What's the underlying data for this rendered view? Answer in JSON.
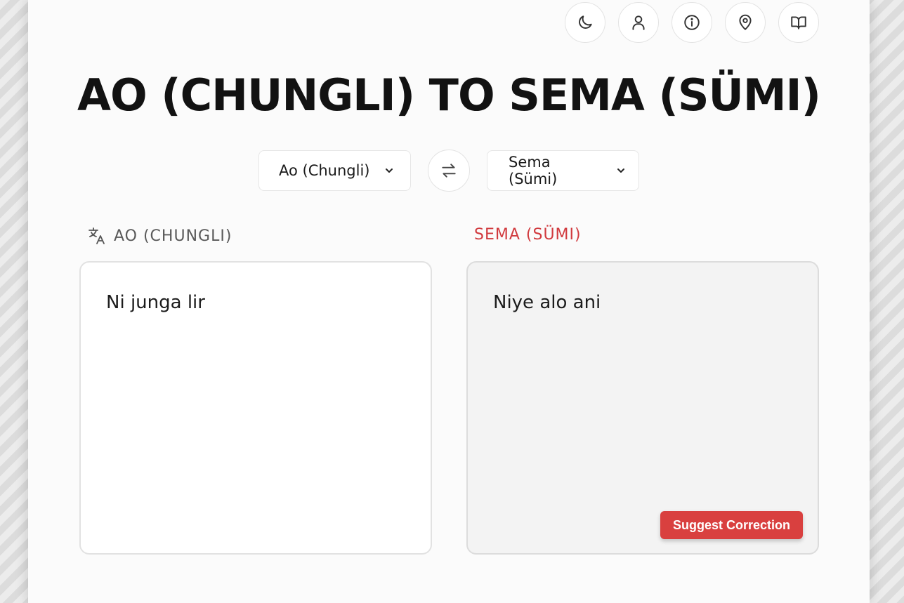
{
  "header": {
    "icons": [
      "moon-icon",
      "user-icon",
      "info-icon",
      "location-pin-icon",
      "book-icon"
    ],
    "title": "AO (CHUNGLI) TO SEMA (SÜMI)"
  },
  "languages": {
    "source": "Ao (Chungli)",
    "target": "Sema (Sümi)",
    "swap_icon": "swap-arrows-icon"
  },
  "source_panel": {
    "label": "AO (CHUNGLI)",
    "icon": "translate-icon",
    "text": "Ni junga lir"
  },
  "target_panel": {
    "label": "SEMA (SÜMI)",
    "text": "Niye alo ani",
    "suggest_button": "Suggest Correction"
  },
  "colors": {
    "accent": "#d13a3e",
    "button": "#d9403f",
    "title": "#121212"
  }
}
